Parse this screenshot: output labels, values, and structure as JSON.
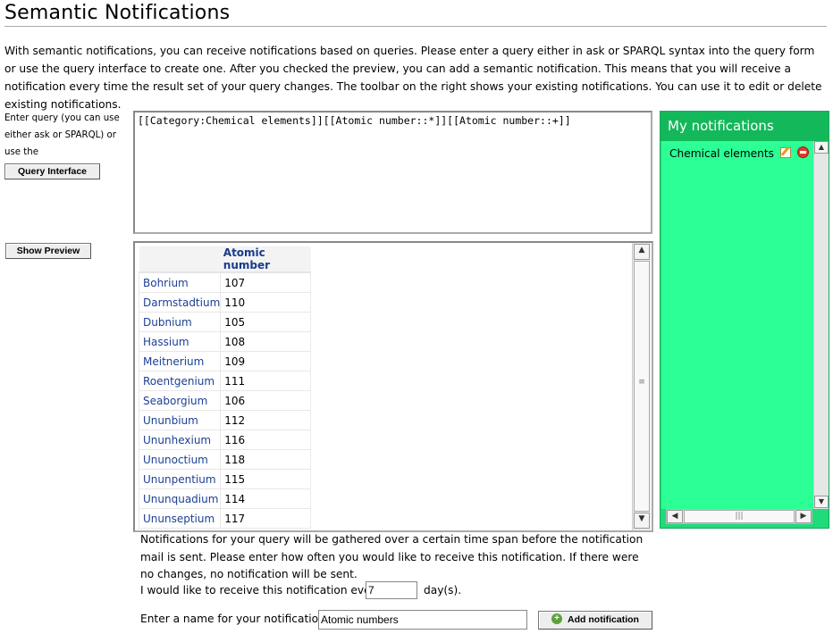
{
  "page": {
    "title": "Semantic Notifications",
    "intro": "With semantic notifications, you can receive notifications based on queries. Please enter a query either in ask or SPARQL syntax into the query form or use the query interface to create one. After you checked the preview, you can add a semantic notification. This means that you will receive a notification every time the result set of your query changes. The toolbar on the right shows your existing notifications. You can use it to edit or delete existing notifications."
  },
  "query": {
    "label": "Enter query (you can use either ask or SPARQL) or use the",
    "interface_button": "Query Interface",
    "value": "[[Category:Chemical elements]][[Atomic number::*]][[Atomic number::+]]",
    "preview_button": "Show Preview"
  },
  "preview": {
    "columns": [
      "",
      "Atomic number"
    ],
    "rows": [
      {
        "name": "Bohrium",
        "number": "107"
      },
      {
        "name": "Darmstadtium",
        "number": "110"
      },
      {
        "name": "Dubnium",
        "number": "105"
      },
      {
        "name": "Hassium",
        "number": "108"
      },
      {
        "name": "Meitnerium",
        "number": "109"
      },
      {
        "name": "Roentgenium",
        "number": "111"
      },
      {
        "name": "Seaborgium",
        "number": "106"
      },
      {
        "name": "Ununbium",
        "number": "112"
      },
      {
        "name": "Ununhexium",
        "number": "116"
      },
      {
        "name": "Ununoctium",
        "number": "118"
      },
      {
        "name": "Ununpentium",
        "number": "115"
      },
      {
        "name": "Ununquadium",
        "number": "114"
      },
      {
        "name": "Ununseptium",
        "number": "117"
      }
    ]
  },
  "notification": {
    "info": "Notifications for your query will be gathered over a certain time span before the notification mail is sent. Please enter how often you would like to receive this notification. If there were no changes, no notification will be sent.",
    "frequency_prefix": "I would like to receive this notification every",
    "frequency_value": "7",
    "frequency_suffix": "day(s).",
    "name_label": "Enter a name for your notification:",
    "name_value": "Atomic numbers",
    "add_button": "Add notification"
  },
  "sidebar": {
    "title": "My notifications",
    "items": [
      {
        "label": "Chemical elements",
        "icons": [
          "edit-icon",
          "delete-icon"
        ]
      }
    ]
  },
  "colors": {
    "link": "#1c3f94",
    "panel_header": "#13b85a",
    "panel_body": "#2cff96"
  }
}
